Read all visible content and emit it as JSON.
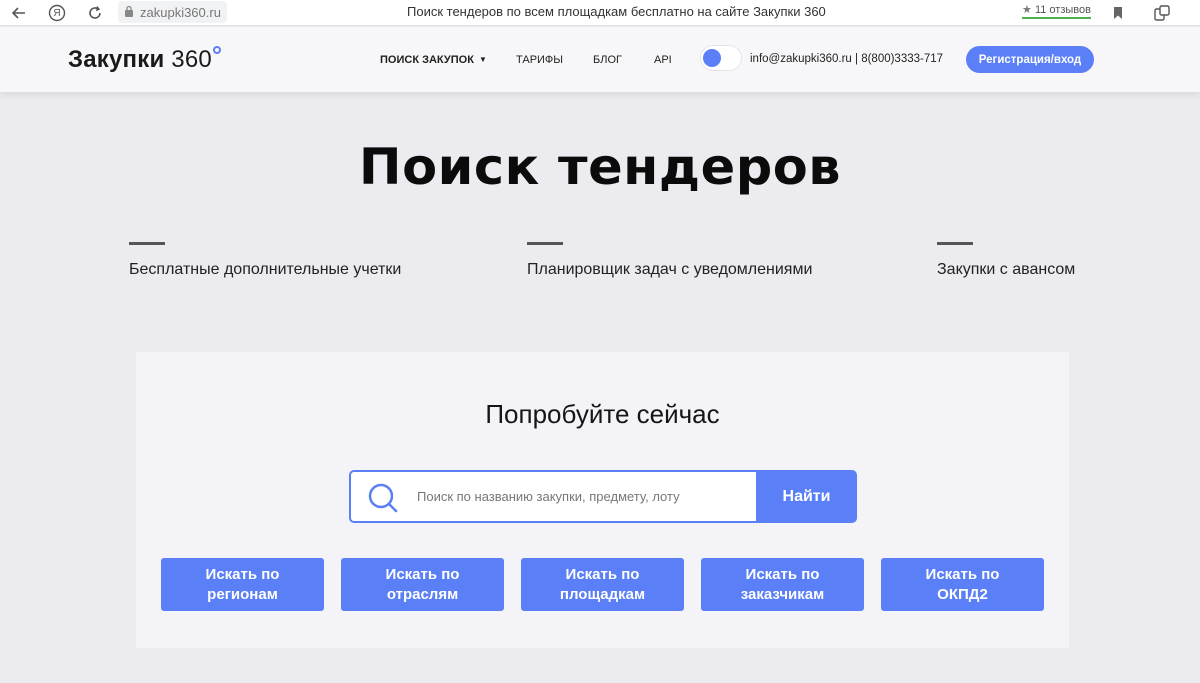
{
  "browser": {
    "url": "zakupki360.ru",
    "tab_title": "Поиск тендеров по всем площадкам бесплатно на сайте Закупки 360",
    "reviews_star": "★",
    "reviews": "11 отзывов",
    "ya_glyph": "Я"
  },
  "header": {
    "logo_word": "Закупки",
    "logo_num": "360",
    "nav": {
      "search": "ПОИСК ЗАКУПОК",
      "tariffs": "ТАРИФЫ",
      "blog": "БЛОГ",
      "api": "API"
    },
    "contacts": "info@zakupki360.ru | 8(800)3333-717",
    "auth_button": "Регистрация/вход"
  },
  "hero": {
    "title": "Поиск тендеров",
    "features": [
      "Бесплатные дополнительные учетки",
      "Планировщик задач с уведомлениями",
      "Закупки с авансом"
    ]
  },
  "search": {
    "title": "Попробуйте сейчас",
    "placeholder": "Поиск по названию закупки, предмету, лоту",
    "button": "Найти",
    "filters": [
      {
        "line1": "Искать по",
        "line2": "регионам"
      },
      {
        "line1": "Искать по",
        "line2": "отраслям"
      },
      {
        "line1": "Искать по",
        "line2": "площадкам"
      },
      {
        "line1": "Искать по",
        "line2": "заказчикам"
      },
      {
        "line1": "Искать по",
        "line2": "ОКПД2"
      }
    ]
  },
  "colors": {
    "accent": "#5b7ff6",
    "background": "#ececf0",
    "card": "#f4f4f8"
  },
  "icons": [
    "back-arrow-icon",
    "yandex-icon",
    "reload-icon",
    "lock-icon",
    "bookmark-icon",
    "extension-icon",
    "chevron-down-icon",
    "search-icon"
  ]
}
